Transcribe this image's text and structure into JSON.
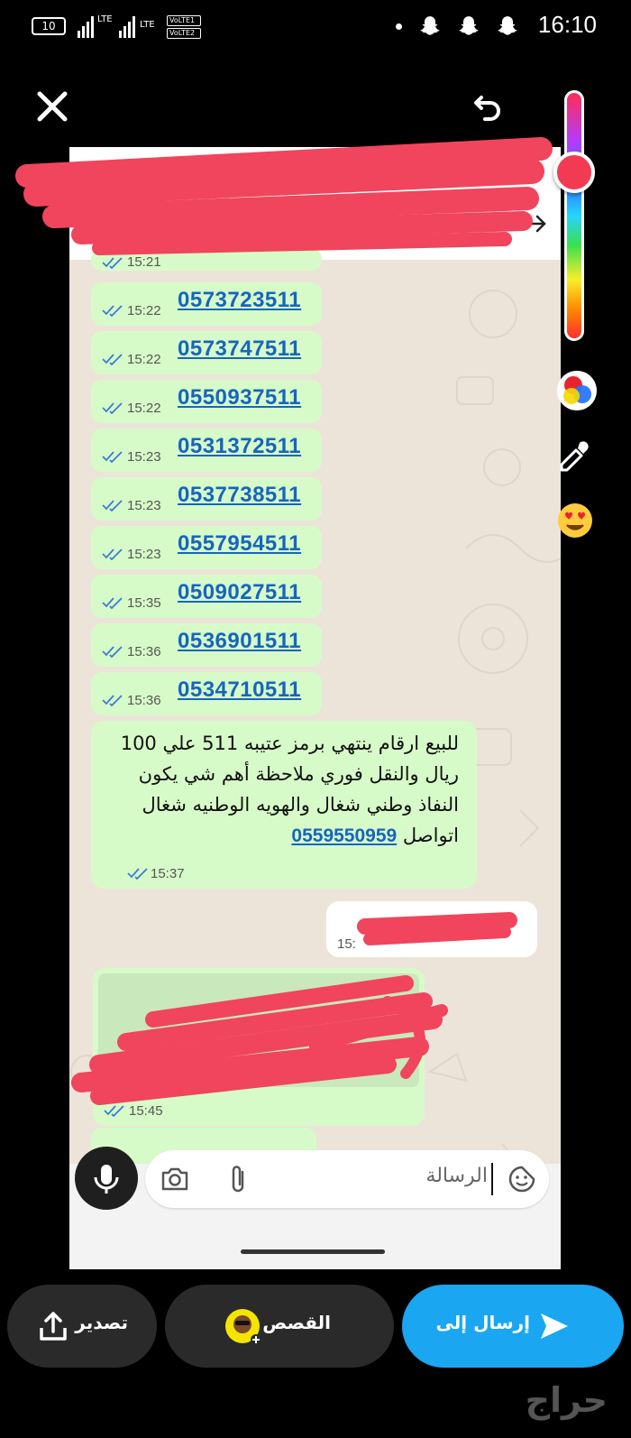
{
  "status_bar": {
    "battery": "10",
    "network_1": "LTE",
    "network_2": "LTE",
    "volte_1": "VoLTE1",
    "volte_2": "VoLTE2",
    "time": "16:10"
  },
  "chat": {
    "messages": [
      {
        "number": "0573723511",
        "time": "15:22"
      },
      {
        "number": "0573747511",
        "time": "15:22"
      },
      {
        "number": "0550937511",
        "time": "15:22"
      },
      {
        "number": "0531372511",
        "time": "15:23"
      },
      {
        "number": "0537738511",
        "time": "15:23"
      },
      {
        "number": "0557954511",
        "time": "15:23"
      },
      {
        "number": "0509027511",
        "time": "15:35"
      },
      {
        "number": "0536901511",
        "time": "15:36"
      },
      {
        "number": "0534710511",
        "time": "15:36"
      }
    ],
    "partial_top_time": "15:21",
    "long_message": {
      "line1": "للبيع ارقام ينتهي برمز عتيبه 511 علي 100",
      "line2": "ريال والنقل فوري ملاحظة أهم شي يكون",
      "line3": "النفاذ وطني شغال والهويه الوطنيه شغال",
      "line4_text": "اتواصل",
      "line4_link": "0559550959",
      "time": "15:37"
    },
    "incoming_time": "15:",
    "big_message_time": "15:45",
    "compose_placeholder": "الرسالة"
  },
  "bottom_bar": {
    "export_label": "تصدير",
    "stories_label": "القصص",
    "send_label": "إرسال إلى"
  },
  "watermark": "حراج",
  "colors": {
    "bubble_out": "#d7fbc8",
    "link": "#1565c0",
    "send_button": "#1aa6f0",
    "redaction": "#f0455c"
  },
  "icons": [
    "close-icon",
    "undo-icon",
    "color-palette-icon",
    "eyedropper-icon",
    "emoji-icon",
    "mic-icon",
    "camera-icon",
    "attachment-icon",
    "sticker-icon",
    "export-icon",
    "send-icon",
    "snapchat-ghost-icon"
  ]
}
